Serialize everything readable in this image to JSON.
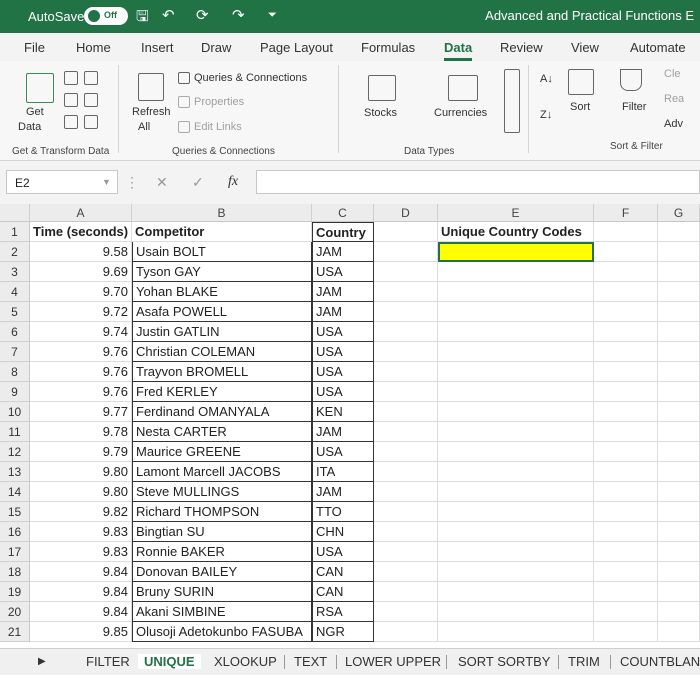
{
  "title_bar": {
    "autosave_label": "AutoSave",
    "autosave_state": "Off",
    "document_title": "Advanced and Practical Functions E"
  },
  "tabs": [
    "File",
    "Home",
    "Insert",
    "Draw",
    "Page Layout",
    "Formulas",
    "Data",
    "Review",
    "View",
    "Automate"
  ],
  "active_tab": "Data",
  "ribbon": {
    "get_data": "Get Data",
    "get_data_line1": "Get",
    "get_data_line2": "Data",
    "group_get_transform": "Get & Transform Data",
    "refresh_all_line1": "Refresh",
    "refresh_all_line2": "All",
    "queries_connections": "Queries & Connections",
    "properties": "Properties",
    "edit_links": "Edit Links",
    "group_queries": "Queries & Connections",
    "stocks": "Stocks",
    "currencies": "Currencies",
    "group_data_types": "Data Types",
    "sort": "Sort",
    "filter": "Filter",
    "clear": "Cle",
    "reapply": "Rea",
    "advanced": "Adv",
    "group_sort_filter": "Sort & Filter"
  },
  "formula_bar": {
    "name_box": "E2",
    "fx": "fx",
    "formula": ""
  },
  "columns": [
    "A",
    "B",
    "C",
    "D",
    "E",
    "F",
    "G"
  ],
  "headers": {
    "time": "Time (seconds)",
    "competitor": "Competitor",
    "country": "Country",
    "unique": "Unique Country Codes"
  },
  "rows": [
    {
      "n": "2",
      "time": "9.58",
      "name": "Usain BOLT",
      "country": "JAM"
    },
    {
      "n": "3",
      "time": "9.69",
      "name": "Tyson GAY",
      "country": "USA"
    },
    {
      "n": "4",
      "time": "9.70",
      "name": "Yohan BLAKE",
      "country": "JAM"
    },
    {
      "n": "5",
      "time": "9.72",
      "name": "Asafa POWELL",
      "country": "JAM"
    },
    {
      "n": "6",
      "time": "9.74",
      "name": "Justin GATLIN",
      "country": "USA"
    },
    {
      "n": "7",
      "time": "9.76",
      "name": "Christian COLEMAN",
      "country": "USA"
    },
    {
      "n": "8",
      "time": "9.76",
      "name": "Trayvon BROMELL",
      "country": "USA"
    },
    {
      "n": "9",
      "time": "9.76",
      "name": "Fred KERLEY",
      "country": "USA"
    },
    {
      "n": "10",
      "time": "9.77",
      "name": "Ferdinand OMANYALA",
      "country": "KEN"
    },
    {
      "n": "11",
      "time": "9.78",
      "name": "Nesta CARTER",
      "country": "JAM"
    },
    {
      "n": "12",
      "time": "9.79",
      "name": "Maurice GREENE",
      "country": "USA"
    },
    {
      "n": "13",
      "time": "9.80",
      "name": "Lamont Marcell JACOBS",
      "country": "ITA"
    },
    {
      "n": "14",
      "time": "9.80",
      "name": "Steve MULLINGS",
      "country": "JAM"
    },
    {
      "n": "15",
      "time": "9.82",
      "name": "Richard THOMPSON",
      "country": "TTO"
    },
    {
      "n": "16",
      "time": "9.83",
      "name": "Bingtian SU",
      "country": "CHN"
    },
    {
      "n": "17",
      "time": "9.83",
      "name": "Ronnie BAKER",
      "country": "USA"
    },
    {
      "n": "18",
      "time": "9.84",
      "name": "Donovan BAILEY",
      "country": "CAN"
    },
    {
      "n": "19",
      "time": "9.84",
      "name": "Bruny SURIN",
      "country": "CAN"
    },
    {
      "n": "20",
      "time": "9.84",
      "name": "Akani SIMBINE",
      "country": "RSA"
    },
    {
      "n": "21",
      "time": "9.85",
      "name": "Olusoji Adetokunbo FASUBA",
      "country": "NGR"
    }
  ],
  "sheet_tabs": [
    "FILTER",
    "UNIQUE",
    "XLOOKUP",
    "TEXT",
    "LOWER UPPER",
    "SORT SORTBY",
    "TRIM",
    "COUNTBLAN"
  ],
  "active_sheet": "UNIQUE",
  "colors": {
    "excel_green": "#217346",
    "selected_cell": "#ffff00"
  }
}
